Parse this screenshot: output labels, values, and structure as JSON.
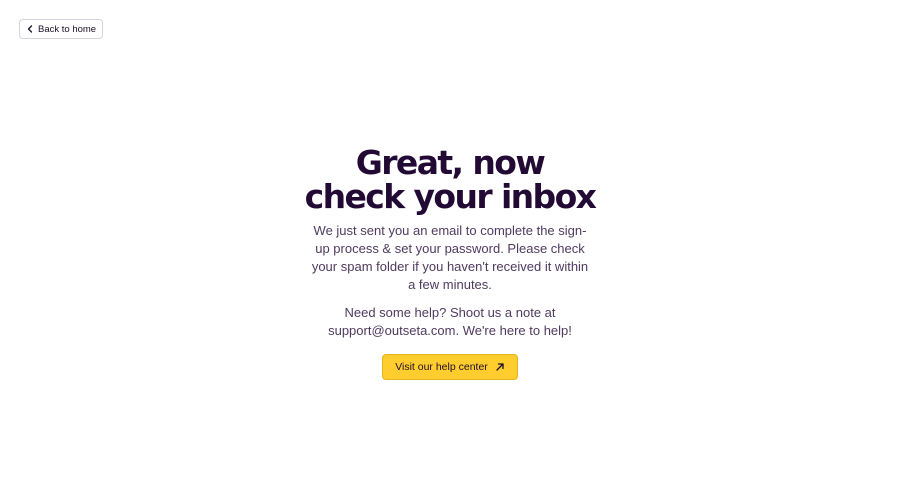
{
  "back_button": {
    "label": "Back to home",
    "icon": "chevron-left-icon"
  },
  "main": {
    "headline_line1": "Great, now",
    "headline_line2": "check your inbox",
    "lead": "We just sent you an email to complete the sign-up process & set your password. Please check your spam folder if you haven't received it within a few minutes.",
    "help": "Need some help? Shoot us a note at support@outseta.com. We're here to help!",
    "cta_label": "Visit our help center",
    "cta_icon": "arrow-up-right-icon"
  },
  "colors": {
    "headline": "#220a35",
    "body_text": "#4f3a5f",
    "cta_background": "#ffcd2e",
    "cta_border": "#e3b51b",
    "back_border": "#d6d3dc"
  }
}
